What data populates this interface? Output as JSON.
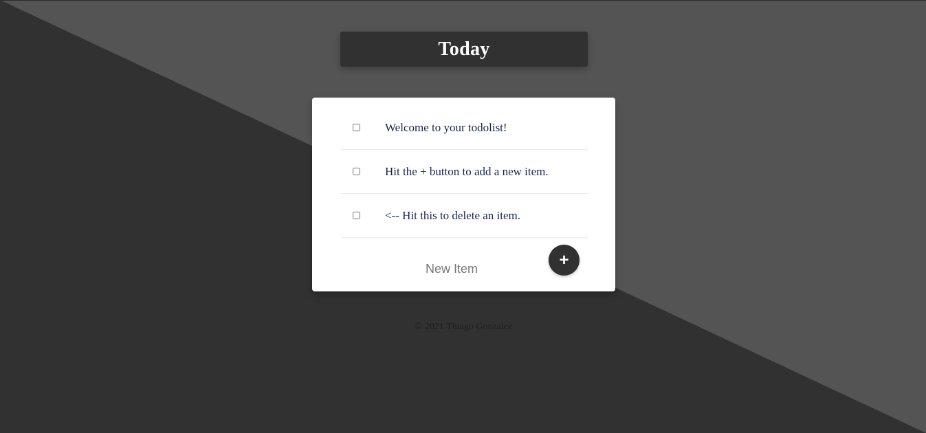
{
  "page": {
    "title": "Today",
    "colors": {
      "background_dark": "#313131",
      "background_light": "#545454",
      "card": "#ffffff",
      "item_text": "#1c2444",
      "button": "#313131"
    }
  },
  "todo": {
    "items": [
      {
        "label": "Welcome to your todolist!",
        "checked": false
      },
      {
        "label": "Hit the + button to add a new item.",
        "checked": false
      },
      {
        "label": "<-- Hit this to delete an item.",
        "checked": false
      }
    ],
    "new_item": {
      "placeholder": "New Item",
      "value": ""
    },
    "add_button": {
      "label": "+",
      "icon": "plus-icon"
    }
  },
  "footer": {
    "text": "© 2021 Thiago Gonzalez"
  }
}
